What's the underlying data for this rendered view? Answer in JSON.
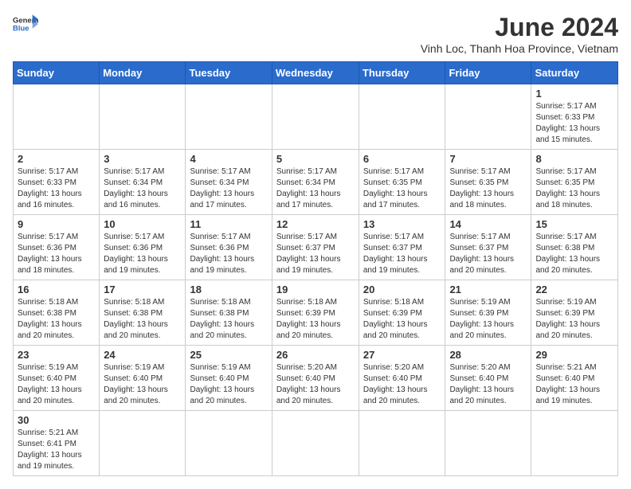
{
  "header": {
    "logo_general": "General",
    "logo_blue": "Blue",
    "title": "June 2024",
    "subtitle": "Vinh Loc, Thanh Hoa Province, Vietnam"
  },
  "weekdays": [
    "Sunday",
    "Monday",
    "Tuesday",
    "Wednesday",
    "Thursday",
    "Friday",
    "Saturday"
  ],
  "weeks": [
    [
      {
        "day": null,
        "info": ""
      },
      {
        "day": null,
        "info": ""
      },
      {
        "day": null,
        "info": ""
      },
      {
        "day": null,
        "info": ""
      },
      {
        "day": null,
        "info": ""
      },
      {
        "day": null,
        "info": ""
      },
      {
        "day": "1",
        "info": "Sunrise: 5:17 AM\nSunset: 6:33 PM\nDaylight: 13 hours and 15 minutes."
      }
    ],
    [
      {
        "day": "2",
        "info": "Sunrise: 5:17 AM\nSunset: 6:33 PM\nDaylight: 13 hours and 16 minutes."
      },
      {
        "day": "3",
        "info": "Sunrise: 5:17 AM\nSunset: 6:34 PM\nDaylight: 13 hours and 16 minutes."
      },
      {
        "day": "4",
        "info": "Sunrise: 5:17 AM\nSunset: 6:34 PM\nDaylight: 13 hours and 17 minutes."
      },
      {
        "day": "5",
        "info": "Sunrise: 5:17 AM\nSunset: 6:34 PM\nDaylight: 13 hours and 17 minutes."
      },
      {
        "day": "6",
        "info": "Sunrise: 5:17 AM\nSunset: 6:35 PM\nDaylight: 13 hours and 17 minutes."
      },
      {
        "day": "7",
        "info": "Sunrise: 5:17 AM\nSunset: 6:35 PM\nDaylight: 13 hours and 18 minutes."
      },
      {
        "day": "8",
        "info": "Sunrise: 5:17 AM\nSunset: 6:35 PM\nDaylight: 13 hours and 18 minutes."
      }
    ],
    [
      {
        "day": "9",
        "info": "Sunrise: 5:17 AM\nSunset: 6:36 PM\nDaylight: 13 hours and 18 minutes."
      },
      {
        "day": "10",
        "info": "Sunrise: 5:17 AM\nSunset: 6:36 PM\nDaylight: 13 hours and 19 minutes."
      },
      {
        "day": "11",
        "info": "Sunrise: 5:17 AM\nSunset: 6:36 PM\nDaylight: 13 hours and 19 minutes."
      },
      {
        "day": "12",
        "info": "Sunrise: 5:17 AM\nSunset: 6:37 PM\nDaylight: 13 hours and 19 minutes."
      },
      {
        "day": "13",
        "info": "Sunrise: 5:17 AM\nSunset: 6:37 PM\nDaylight: 13 hours and 19 minutes."
      },
      {
        "day": "14",
        "info": "Sunrise: 5:17 AM\nSunset: 6:37 PM\nDaylight: 13 hours and 20 minutes."
      },
      {
        "day": "15",
        "info": "Sunrise: 5:17 AM\nSunset: 6:38 PM\nDaylight: 13 hours and 20 minutes."
      }
    ],
    [
      {
        "day": "16",
        "info": "Sunrise: 5:18 AM\nSunset: 6:38 PM\nDaylight: 13 hours and 20 minutes."
      },
      {
        "day": "17",
        "info": "Sunrise: 5:18 AM\nSunset: 6:38 PM\nDaylight: 13 hours and 20 minutes."
      },
      {
        "day": "18",
        "info": "Sunrise: 5:18 AM\nSunset: 6:38 PM\nDaylight: 13 hours and 20 minutes."
      },
      {
        "day": "19",
        "info": "Sunrise: 5:18 AM\nSunset: 6:39 PM\nDaylight: 13 hours and 20 minutes."
      },
      {
        "day": "20",
        "info": "Sunrise: 5:18 AM\nSunset: 6:39 PM\nDaylight: 13 hours and 20 minutes."
      },
      {
        "day": "21",
        "info": "Sunrise: 5:19 AM\nSunset: 6:39 PM\nDaylight: 13 hours and 20 minutes."
      },
      {
        "day": "22",
        "info": "Sunrise: 5:19 AM\nSunset: 6:39 PM\nDaylight: 13 hours and 20 minutes."
      }
    ],
    [
      {
        "day": "23",
        "info": "Sunrise: 5:19 AM\nSunset: 6:40 PM\nDaylight: 13 hours and 20 minutes."
      },
      {
        "day": "24",
        "info": "Sunrise: 5:19 AM\nSunset: 6:40 PM\nDaylight: 13 hours and 20 minutes."
      },
      {
        "day": "25",
        "info": "Sunrise: 5:19 AM\nSunset: 6:40 PM\nDaylight: 13 hours and 20 minutes."
      },
      {
        "day": "26",
        "info": "Sunrise: 5:20 AM\nSunset: 6:40 PM\nDaylight: 13 hours and 20 minutes."
      },
      {
        "day": "27",
        "info": "Sunrise: 5:20 AM\nSunset: 6:40 PM\nDaylight: 13 hours and 20 minutes."
      },
      {
        "day": "28",
        "info": "Sunrise: 5:20 AM\nSunset: 6:40 PM\nDaylight: 13 hours and 20 minutes."
      },
      {
        "day": "29",
        "info": "Sunrise: 5:21 AM\nSunset: 6:40 PM\nDaylight: 13 hours and 19 minutes."
      }
    ],
    [
      {
        "day": "30",
        "info": "Sunrise: 5:21 AM\nSunset: 6:41 PM\nDaylight: 13 hours and 19 minutes."
      },
      {
        "day": null,
        "info": ""
      },
      {
        "day": null,
        "info": ""
      },
      {
        "day": null,
        "info": ""
      },
      {
        "day": null,
        "info": ""
      },
      {
        "day": null,
        "info": ""
      },
      {
        "day": null,
        "info": ""
      }
    ]
  ]
}
